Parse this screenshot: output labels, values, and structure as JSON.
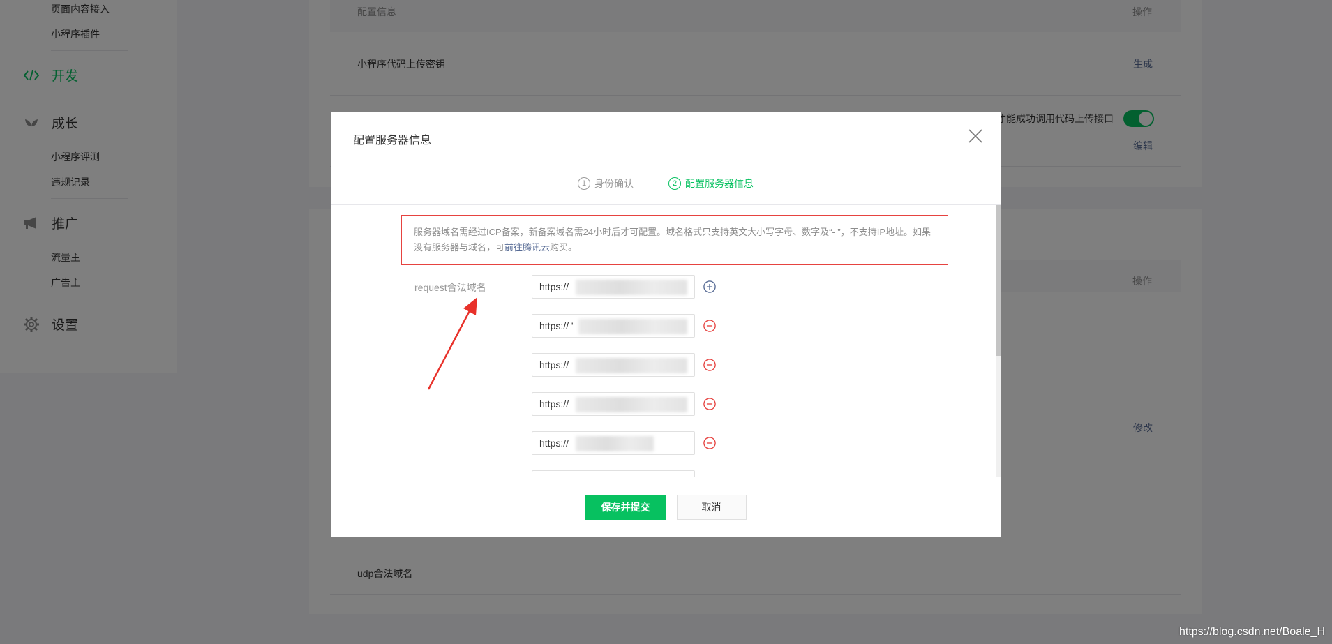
{
  "sidebar": {
    "top_items": [
      "页面内容接入",
      "小程序插件"
    ],
    "groups": {
      "develop": "开发",
      "growth": "成长",
      "promote": "推广",
      "settings": "设置"
    },
    "growth_items": [
      "小程序评测",
      "违规记录"
    ],
    "promote_items": [
      "流量主",
      "广告主"
    ]
  },
  "background": {
    "header_config": "配置信息",
    "header_action": "操作",
    "upload_key_label": "小程序代码上传密钥",
    "generate_link": "生成",
    "ip_whitelist_hint": "才能成功调用代码上传接口",
    "edit_link": "编辑",
    "header_action_2": "操作",
    "modify_link": "修改",
    "udp_label": "udp合法域名"
  },
  "dialog": {
    "title": "配置服务器信息",
    "steps": [
      {
        "num": "1",
        "label": "身份确认"
      },
      {
        "num": "2",
        "label": "配置服务器信息"
      }
    ],
    "notice_text": "服务器域名需经过ICP备案，新备案域名需24小时后才可配置。域名格式只支持英文大小写字母、数字及“- ”，不支持IP地址。如果没有服务器与域名，可",
    "notice_link": "前往腾讯云",
    "notice_suffix": "购买。",
    "request_label": "request合法域名",
    "domains": [
      {
        "prefix": "https://"
      },
      {
        "prefix": "https:// '"
      },
      {
        "prefix": "https://"
      },
      {
        "prefix": "https://"
      },
      {
        "prefix": "https://"
      }
    ],
    "save_button": "保存并提交",
    "cancel_button": "取消"
  },
  "watermark": "https://blog.csdn.net/Boale_H",
  "colors": {
    "brand_green": "#07c160",
    "danger_red": "#e64340",
    "link_blue": "#576b95"
  }
}
